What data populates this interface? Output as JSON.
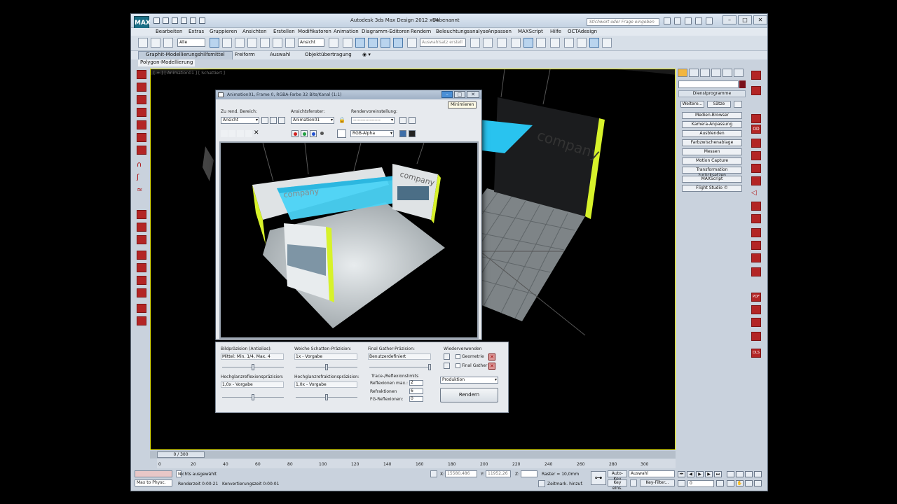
{
  "app": {
    "title": "Autodesk 3ds Max Design 2012 x64",
    "file": "Unbenannt",
    "logo": "MAX",
    "search_placeholder": "Stichwort oder Frage eingeben"
  },
  "menu": [
    "Bearbeiten",
    "Extras",
    "Gruppieren",
    "Ansichten",
    "Erstellen",
    "Modifikatoren",
    "Animation",
    "Diagramm-Editoren",
    "Rendern",
    "Beleuchtungsanalyse",
    "Anpassen",
    "MAXScript",
    "Hilfe",
    "OCTAdesign"
  ],
  "toolbar": {
    "filter_select": "Alle",
    "coord_select": "Ansicht",
    "named_sel_placeholder": "Auswahlsatz erstell"
  },
  "ribbon": {
    "tabs": [
      "Graphit-Modellierungshilfsmittel",
      "Freiform",
      "Auswahl",
      "Objektübertragung"
    ],
    "panel": "Polygon-Modellierung"
  },
  "viewport": {
    "label": "[ + ] [ Animation01 ] [ Schattiert ]",
    "scene_text": "company"
  },
  "command_panel": {
    "rollout": "Dienstprogramme",
    "small_buttons": [
      "Weitere...",
      "Sätze"
    ],
    "buttons": [
      "Medien-Browser",
      "Kamera-Anpassung",
      "Ausblenden",
      "Farbzwischenablage",
      "Messen",
      "Motion Capture",
      "Transformation zurücksetzen",
      "MAXScript",
      "Flight Studio ©"
    ]
  },
  "frame_window": {
    "title": "Animation01, Frame 0, RGBA-Farbe 32 Bits/Kanal (1:1)",
    "tooltip": "Minimieren",
    "area_label": "Zu rend. Bereich:",
    "area_value": "Ansicht",
    "viewport_label": "Ansichtsfenster:",
    "viewport_value": "Animation01",
    "preset_label": "Rendervoreinstellung:",
    "preset_value": "------------------",
    "channel_value": "RGB-Alpha"
  },
  "render_settings": {
    "img_precision_label": "Bildpräzision (Antialias):",
    "img_precision_value": "Mittel: Min. 1/4, Max. 4",
    "soft_shadow_label": "Weiche Schatten-Präzision:",
    "soft_shadow_value": "1x - Vorgabe",
    "fg_label": "Final Gather-Präzision:",
    "fg_value": "Benutzerdefiniert",
    "reuse_label": "Wiederverwenden",
    "geometry_label": "Geometrie",
    "final_gather_label": "Final Gather",
    "gloss_refl_label": "Hochglanzreflexionspräzision:",
    "gloss_refl_value": "1,0x - Vorgabe",
    "gloss_refr_label": "Hochglanzrefraktionspräzision:",
    "gloss_refr_value": "1,0x - Vorgabe",
    "trace_label": "Trace-/Reflexionslimits",
    "reflections_label": "Reflexionen max.:",
    "reflections_value": "2",
    "refractions_label": "Refraktionen",
    "refractions_value": "6",
    "fg_reflections_label": "FG-Reflexionen:",
    "fg_reflections_value": "0",
    "mode_value": "Produktion",
    "render_button": "Rendern"
  },
  "timeline": {
    "slider": "0 / 300",
    "ticks": [
      "0",
      "20",
      "40",
      "60",
      "80",
      "100",
      "120",
      "140",
      "160",
      "180",
      "200",
      "220",
      "240",
      "260",
      "280",
      "300"
    ]
  },
  "status": {
    "maxscript": "Max to Physc.",
    "selection": "Nichts ausgewählt",
    "render_time": "Renderzeit 0:00:21",
    "convert_time": "Konvertierungszeit 0:00:01",
    "x_value": "15580,486",
    "y_value": "11952,26",
    "z_label": "Z:",
    "x_label": "X:",
    "y_label": "Y:",
    "grid": "Raster = 10,0mm",
    "time_tag": "Zeitmark. hinzuf.",
    "autokey": "Auto-Key",
    "setkey": "Key eins.",
    "auswahl": "Auswahl",
    "keyfilter": "Key-Filter...",
    "frame": "0"
  },
  "colors": {
    "accent_yellow": "#e6e600",
    "accent_red": "#b32525",
    "booth_cyan": "#29c3ef",
    "booth_lime": "#d7f22a"
  }
}
